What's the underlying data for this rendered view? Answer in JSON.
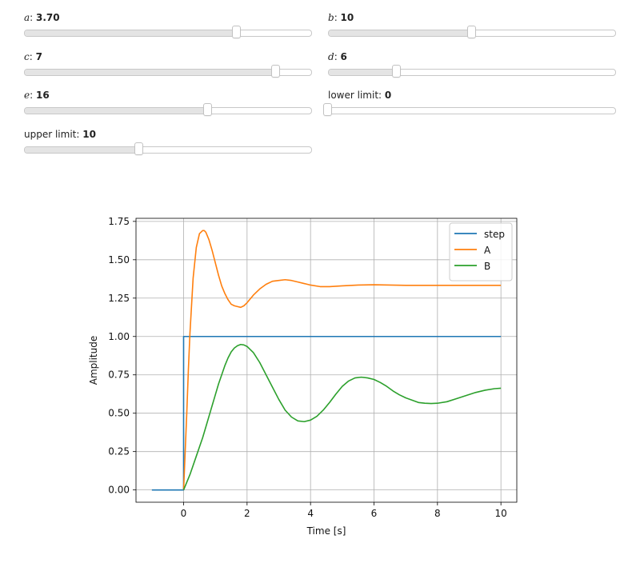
{
  "sliders": [
    {
      "symbol": "a",
      "label": "",
      "value": 3.7,
      "display": "3.70",
      "min": 0,
      "max": 5
    },
    {
      "symbol": "b",
      "label": "",
      "value": 10,
      "display": "10",
      "min": 0,
      "max": 20
    },
    {
      "symbol": "c",
      "label": "",
      "value": 7,
      "display": "7",
      "min": 0,
      "max": 8
    },
    {
      "symbol": "d",
      "label": "",
      "value": 6,
      "display": "6",
      "min": 0,
      "max": 25
    },
    {
      "symbol": "e",
      "label": "",
      "value": 16,
      "display": "16",
      "min": 0,
      "max": 25
    },
    {
      "symbol": "",
      "label": "lower limit",
      "value": 0,
      "display": "0",
      "min": 0,
      "max": 10
    },
    {
      "symbol": "",
      "label": "upper limit",
      "value": 10,
      "display": "10",
      "min": 0,
      "max": 25
    }
  ],
  "chart_data": {
    "type": "line",
    "xlabel": "Time [s]",
    "ylabel": "Amplitude",
    "xlim": [
      -1.5,
      10.5
    ],
    "ylim": [
      -0.08,
      1.77
    ],
    "xticks": [
      0,
      2,
      4,
      6,
      8,
      10
    ],
    "xtick_labels": [
      "0",
      "2",
      "4",
      "6",
      "8",
      "10"
    ],
    "yticks": [
      0.0,
      0.25,
      0.5,
      0.75,
      1.0,
      1.25,
      1.5,
      1.75
    ],
    "ytick_labels": [
      "0.00",
      "0.25",
      "0.50",
      "0.75",
      "1.00",
      "1.25",
      "1.50",
      "1.75"
    ],
    "grid": true,
    "legend_position": "top-right",
    "series": [
      {
        "name": "step",
        "color": "#1f77b4",
        "x": [
          -1.0,
          0.0,
          0.0,
          0.02,
          10.0
        ],
        "y": [
          0.0,
          0.0,
          1.0,
          1.0,
          1.0
        ]
      },
      {
        "name": "A",
        "color": "#ff7f0e",
        "x": [
          0.0,
          0.05,
          0.1,
          0.15,
          0.2,
          0.3,
          0.4,
          0.5,
          0.6,
          0.65,
          0.7,
          0.8,
          0.9,
          1.0,
          1.1,
          1.2,
          1.3,
          1.4,
          1.5,
          1.6,
          1.7,
          1.8,
          1.9,
          2.0,
          2.2,
          2.4,
          2.6,
          2.8,
          3.0,
          3.2,
          3.4,
          3.6,
          3.8,
          4.0,
          4.3,
          4.6,
          5.0,
          5.5,
          6.0,
          6.5,
          7.0,
          7.5,
          8.0,
          9.0,
          10.0
        ],
        "y": [
          0.0,
          0.25,
          0.5,
          0.78,
          1.02,
          1.38,
          1.58,
          1.67,
          1.69,
          1.69,
          1.68,
          1.63,
          1.56,
          1.48,
          1.4,
          1.33,
          1.28,
          1.24,
          1.21,
          1.2,
          1.195,
          1.19,
          1.2,
          1.22,
          1.27,
          1.31,
          1.34,
          1.36,
          1.365,
          1.37,
          1.365,
          1.355,
          1.345,
          1.335,
          1.325,
          1.325,
          1.33,
          1.335,
          1.337,
          1.335,
          1.333,
          1.333,
          1.333,
          1.333,
          1.333
        ]
      },
      {
        "name": "B",
        "color": "#2ca02c",
        "x": [
          0.0,
          0.1,
          0.2,
          0.3,
          0.4,
          0.5,
          0.6,
          0.7,
          0.8,
          0.9,
          1.0,
          1.1,
          1.2,
          1.3,
          1.4,
          1.5,
          1.6,
          1.7,
          1.8,
          1.9,
          2.0,
          2.2,
          2.4,
          2.6,
          2.8,
          3.0,
          3.2,
          3.4,
          3.6,
          3.8,
          4.0,
          4.2,
          4.4,
          4.6,
          4.8,
          5.0,
          5.2,
          5.4,
          5.6,
          5.8,
          6.0,
          6.2,
          6.4,
          6.6,
          6.8,
          7.0,
          7.2,
          7.4,
          7.6,
          7.8,
          8.0,
          8.3,
          8.6,
          8.9,
          9.2,
          9.5,
          9.8,
          10.0
        ],
        "y": [
          0.0,
          0.05,
          0.1,
          0.16,
          0.22,
          0.28,
          0.34,
          0.41,
          0.48,
          0.55,
          0.62,
          0.69,
          0.75,
          0.81,
          0.86,
          0.9,
          0.925,
          0.94,
          0.948,
          0.945,
          0.935,
          0.895,
          0.83,
          0.75,
          0.67,
          0.59,
          0.52,
          0.475,
          0.45,
          0.445,
          0.455,
          0.48,
          0.52,
          0.57,
          0.625,
          0.675,
          0.71,
          0.73,
          0.735,
          0.73,
          0.72,
          0.7,
          0.675,
          0.645,
          0.62,
          0.6,
          0.585,
          0.57,
          0.565,
          0.563,
          0.565,
          0.575,
          0.595,
          0.615,
          0.635,
          0.65,
          0.66,
          0.663
        ]
      }
    ]
  }
}
